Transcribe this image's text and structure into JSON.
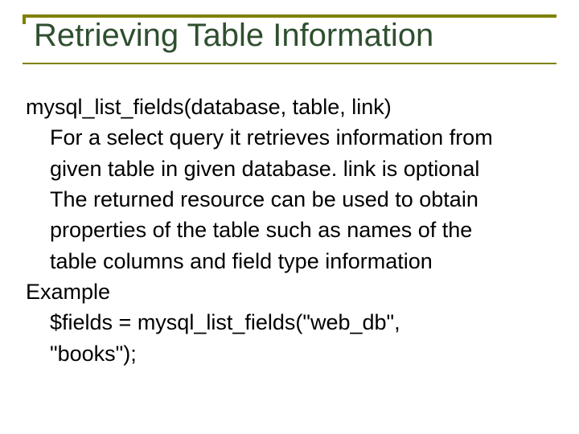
{
  "title": "Retrieving Table Information",
  "signature": "mysql_list_fields(database, table, link)",
  "desc_line1": "For a select query it retrieves information from",
  "desc_line2": "given table in given database. link is optional",
  "desc_line3": "The returned resource can be used to obtain",
  "desc_line4": "properties of the table such as names of the",
  "desc_line5": "table columns and field type information",
  "example_label": "Example",
  "example_code1": "$fields = mysql_list_fields(\"web_db\",",
  "example_code2": "\"books\");"
}
